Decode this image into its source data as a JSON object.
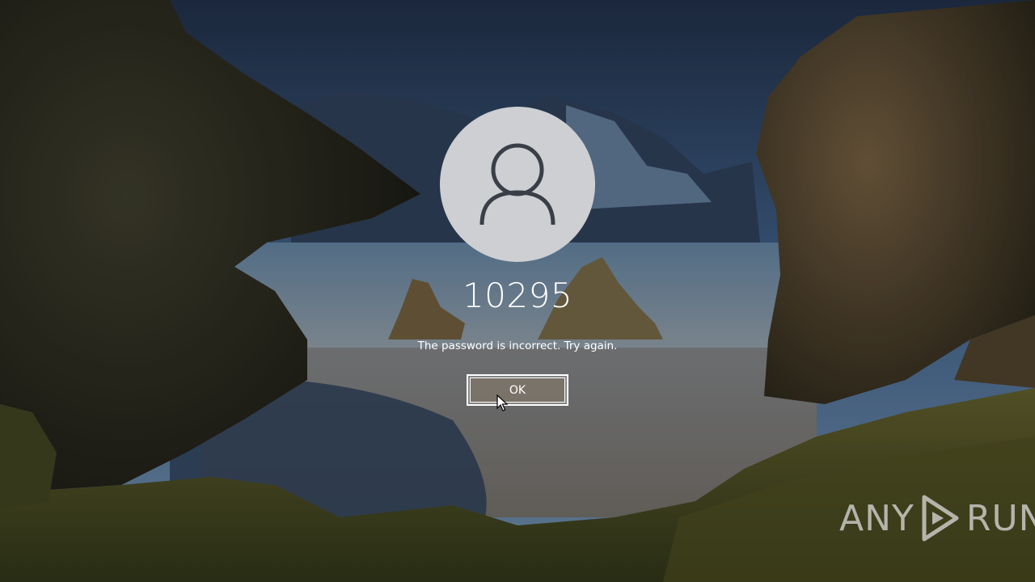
{
  "lock_screen": {
    "username": "10295",
    "message": "The password is incorrect. Try again.",
    "ok_label": "OK",
    "avatar_icon": "user-icon"
  },
  "watermark": {
    "left_text": "ANY",
    "right_text": "RUN",
    "icon": "play-icon"
  },
  "colors": {
    "avatar_bg": "#cdcfd3",
    "avatar_glyph": "#3a3f47",
    "text": "#ffffff",
    "button_fill": "#78706a"
  }
}
